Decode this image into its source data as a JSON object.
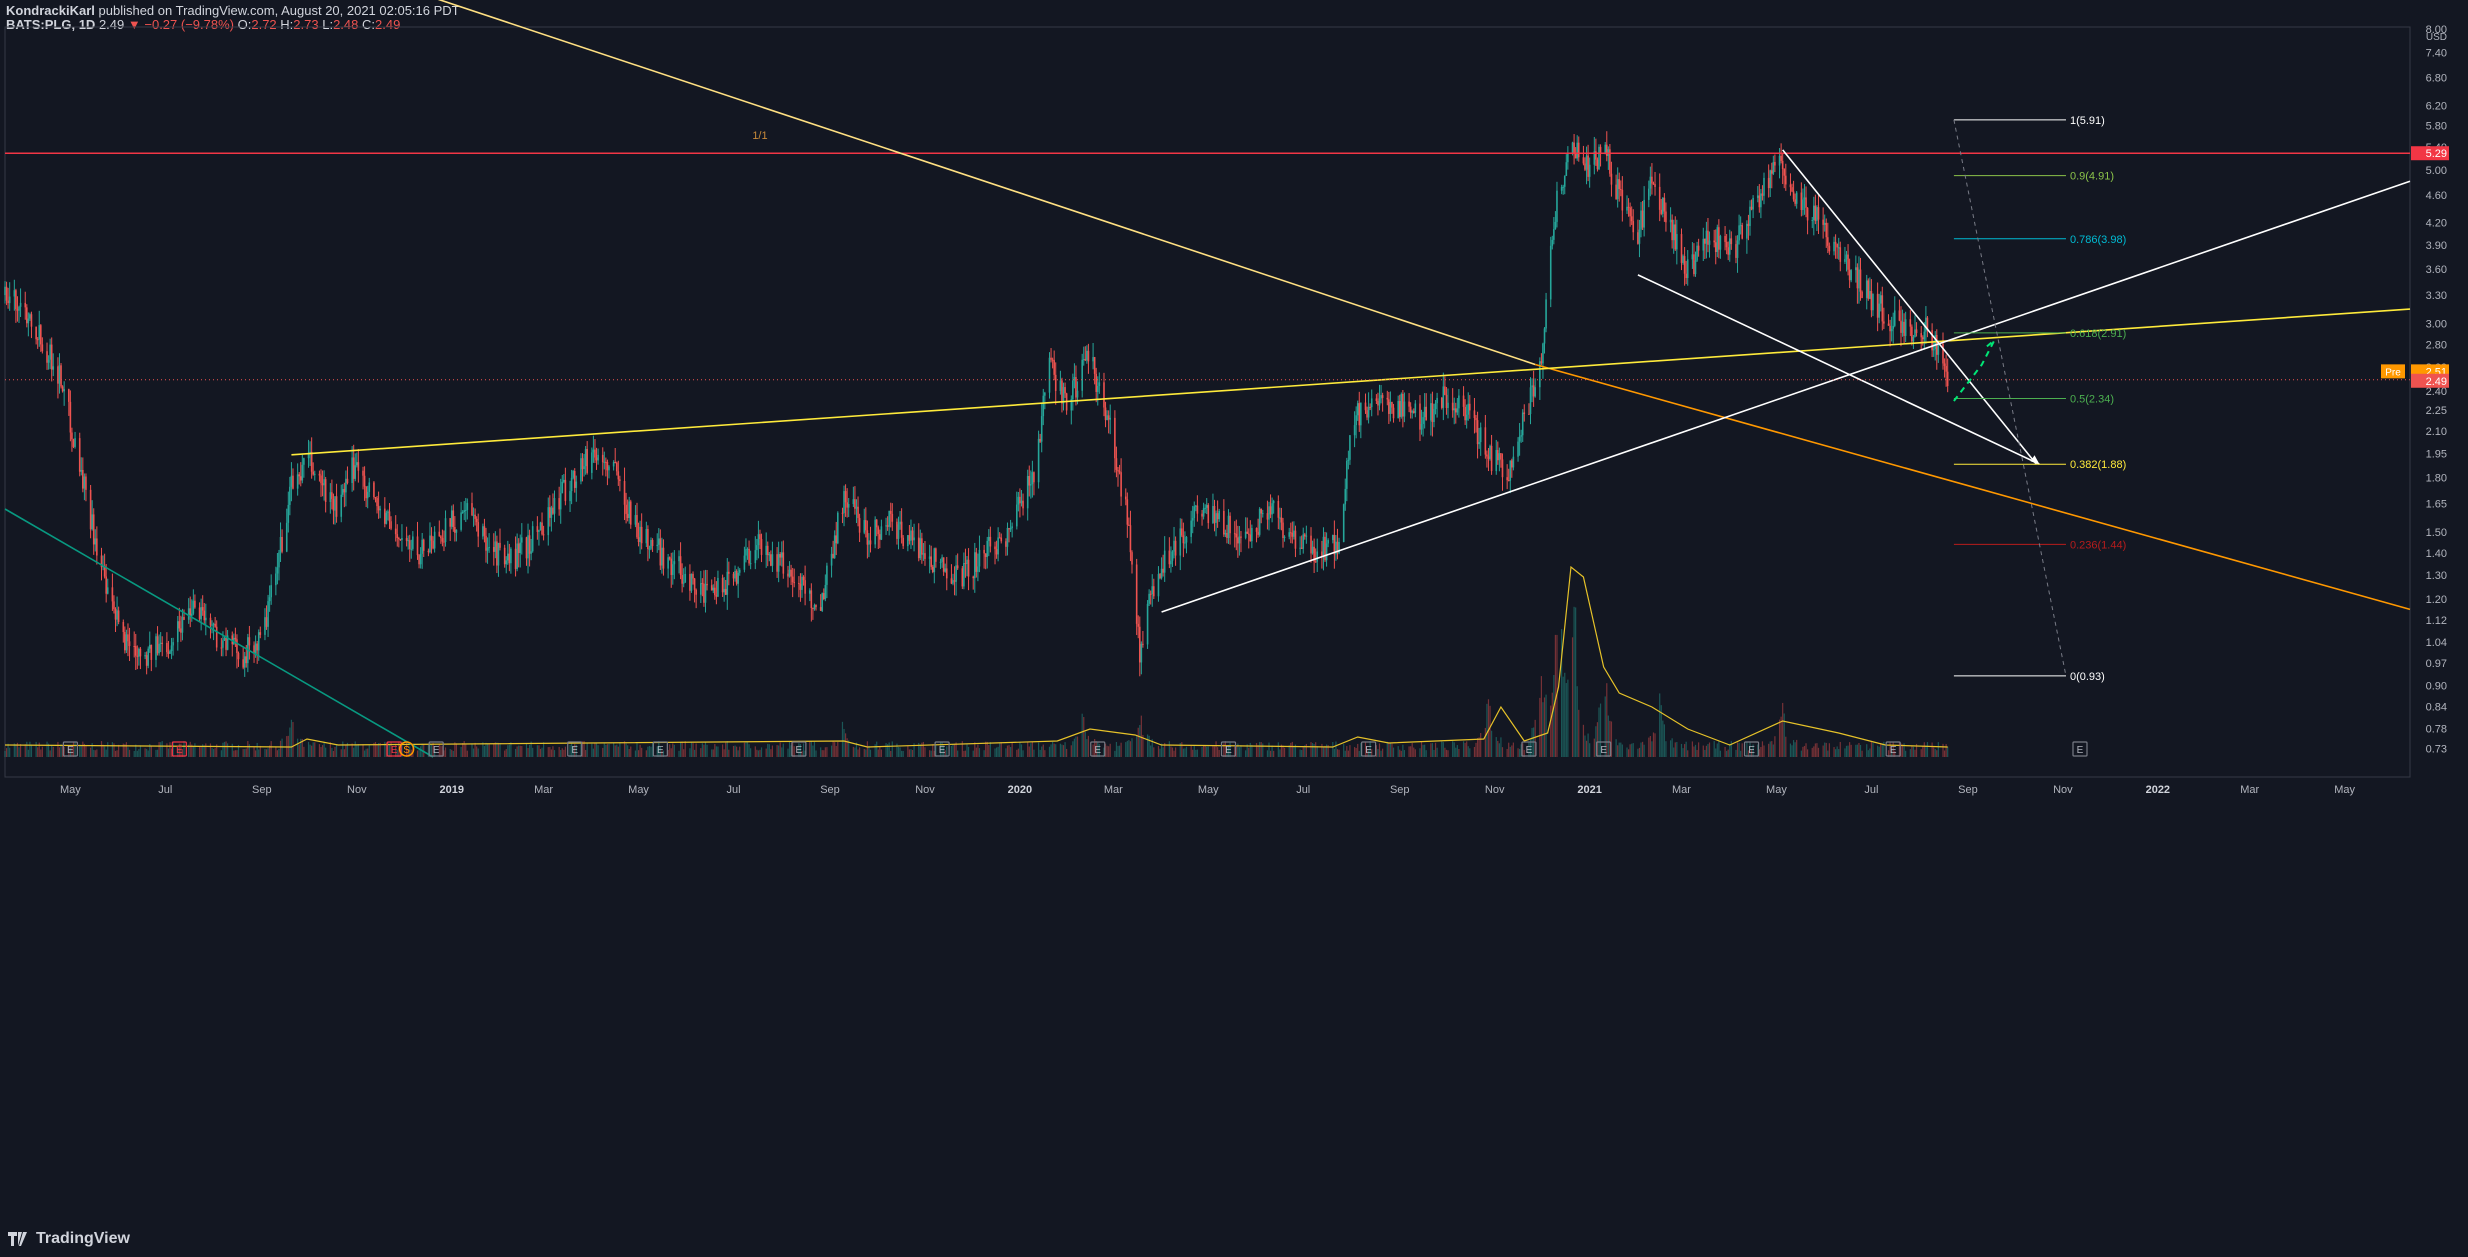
{
  "header": {
    "author": "KondrackiKarl",
    "published": "published on TradingView.com, August 20, 2021 02:05:16 PDT",
    "symbol": "BATS:PLG, 1D",
    "last": "2.49",
    "change": "▼ −0.27 (−9.78%)",
    "o_label": "O:",
    "o": "2.72",
    "h_label": "H:",
    "h": "2.73",
    "l_label": "L:",
    "l": "2.48",
    "c_label": "C:",
    "c": "2.49"
  },
  "watermark": "TradingView",
  "colors": {
    "background": "#131722",
    "up": "#26a69a",
    "down": "#ef5350",
    "trend_yellow": "#ffeb3b",
    "trend_orange": "#ff9800",
    "resistance_red": "#f23645",
    "fib_white": "#ffffff"
  },
  "chart_data": {
    "type": "candlestick",
    "price_scale": {
      "unit": "USD",
      "log": true,
      "ticks": [
        "8.00",
        "7.40",
        "6.80",
        "6.20",
        "5.80",
        "5.40",
        "5.00",
        "4.60",
        "4.20",
        "3.90",
        "3.60",
        "3.30",
        "3.00",
        "2.80",
        "2.60",
        "2.40",
        "2.25",
        "2.10",
        "1.95",
        "1.80",
        "1.65",
        "1.50",
        "1.40",
        "1.30",
        "1.20",
        "1.12",
        "1.04",
        "0.97",
        "0.90",
        "0.84",
        "0.78",
        "0.73"
      ],
      "range": [
        0.71,
        8.05
      ]
    },
    "time_scale": {
      "range": [
        "2018-03-20",
        "2022-06-12"
      ],
      "ticks": [
        {
          "label": "May",
          "date": "2018-05-01"
        },
        {
          "label": "Jul",
          "date": "2018-07-01"
        },
        {
          "label": "Sep",
          "date": "2018-09-01"
        },
        {
          "label": "Nov",
          "date": "2018-11-01"
        },
        {
          "label": "2019",
          "date": "2019-01-01",
          "bold": true
        },
        {
          "label": "Mar",
          "date": "2019-03-01"
        },
        {
          "label": "May",
          "date": "2019-05-01"
        },
        {
          "label": "Jul",
          "date": "2019-07-01"
        },
        {
          "label": "Sep",
          "date": "2019-09-01"
        },
        {
          "label": "Nov",
          "date": "2019-11-01"
        },
        {
          "label": "2020",
          "date": "2020-01-01",
          "bold": true
        },
        {
          "label": "Mar",
          "date": "2020-03-01"
        },
        {
          "label": "May",
          "date": "2020-05-01"
        },
        {
          "label": "Jul",
          "date": "2020-07-01"
        },
        {
          "label": "Sep",
          "date": "2020-09-01"
        },
        {
          "label": "Nov",
          "date": "2020-11-01"
        },
        {
          "label": "2021",
          "date": "2021-01-01",
          "bold": true
        },
        {
          "label": "Mar",
          "date": "2021-03-01"
        },
        {
          "label": "May",
          "date": "2021-05-01"
        },
        {
          "label": "Jul",
          "date": "2021-07-01"
        },
        {
          "label": "Sep",
          "date": "2021-09-01"
        },
        {
          "label": "Nov",
          "date": "2021-11-01"
        },
        {
          "label": "2022",
          "date": "2022-01-01",
          "bold": true
        },
        {
          "label": "Mar",
          "date": "2022-03-01"
        },
        {
          "label": "May",
          "date": "2022-05-01"
        }
      ]
    },
    "price_path": [
      [
        "2018-03-20",
        3.3
      ],
      [
        "2018-04-05",
        3.1
      ],
      [
        "2018-04-25",
        2.5
      ],
      [
        "2018-05-10",
        1.75
      ],
      [
        "2018-05-25",
        1.2
      ],
      [
        "2018-06-05",
        1.05
      ],
      [
        "2018-06-20",
        1.0
      ],
      [
        "2018-07-05",
        1.05
      ],
      [
        "2018-07-20",
        1.2
      ],
      [
        "2018-08-05",
        1.05
      ],
      [
        "2018-08-20",
        1.0
      ],
      [
        "2018-09-01",
        1.05
      ],
      [
        "2018-09-10",
        1.3
      ],
      [
        "2018-09-20",
        1.75
      ],
      [
        "2018-10-01",
        1.9
      ],
      [
        "2018-10-10",
        1.75
      ],
      [
        "2018-10-20",
        1.6
      ],
      [
        "2018-10-31",
        1.9
      ],
      [
        "2018-11-10",
        1.7
      ],
      [
        "2018-11-25",
        1.5
      ],
      [
        "2018-12-10",
        1.4
      ],
      [
        "2018-12-25",
        1.5
      ],
      [
        "2019-01-10",
        1.6
      ],
      [
        "2019-01-25",
        1.45
      ],
      [
        "2019-02-05",
        1.35
      ],
      [
        "2019-02-20",
        1.45
      ],
      [
        "2019-03-05",
        1.6
      ],
      [
        "2019-03-20",
        1.8
      ],
      [
        "2019-04-01",
        1.95
      ],
      [
        "2019-04-15",
        1.85
      ],
      [
        "2019-05-01",
        1.5
      ],
      [
        "2019-05-15",
        1.4
      ],
      [
        "2019-06-01",
        1.3
      ],
      [
        "2019-06-15",
        1.2
      ],
      [
        "2019-07-01",
        1.3
      ],
      [
        "2019-07-15",
        1.45
      ],
      [
        "2019-08-01",
        1.35
      ],
      [
        "2019-08-15",
        1.25
      ],
      [
        "2019-08-25",
        1.15
      ],
      [
        "2019-09-10",
        1.7
      ],
      [
        "2019-09-25",
        1.5
      ],
      [
        "2019-10-10",
        1.55
      ],
      [
        "2019-10-25",
        1.45
      ],
      [
        "2019-11-10",
        1.35
      ],
      [
        "2019-11-25",
        1.3
      ],
      [
        "2019-12-10",
        1.4
      ],
      [
        "2019-12-25",
        1.5
      ],
      [
        "2020-01-10",
        1.85
      ],
      [
        "2020-01-20",
        2.6
      ],
      [
        "2020-02-01",
        2.3
      ],
      [
        "2020-02-15",
        2.7
      ],
      [
        "2020-02-28",
        2.1
      ],
      [
        "2020-03-10",
        1.6
      ],
      [
        "2020-03-18",
        1.0
      ],
      [
        "2020-03-28",
        1.3
      ],
      [
        "2020-04-10",
        1.45
      ],
      [
        "2020-04-25",
        1.6
      ],
      [
        "2020-05-10",
        1.55
      ],
      [
        "2020-05-25",
        1.45
      ],
      [
        "2020-06-10",
        1.65
      ],
      [
        "2020-06-25",
        1.45
      ],
      [
        "2020-07-10",
        1.4
      ],
      [
        "2020-07-25",
        1.45
      ],
      [
        "2020-08-01",
        2.2
      ],
      [
        "2020-08-15",
        2.25
      ],
      [
        "2020-09-01",
        2.3
      ],
      [
        "2020-09-15",
        2.2
      ],
      [
        "2020-10-01",
        2.35
      ],
      [
        "2020-10-15",
        2.2
      ],
      [
        "2020-10-31",
        1.9
      ],
      [
        "2020-11-10",
        1.85
      ],
      [
        "2020-11-20",
        2.2
      ],
      [
        "2020-12-01",
        2.7
      ],
      [
        "2020-12-10",
        4.4
      ],
      [
        "2020-12-20",
        5.5
      ],
      [
        "2020-12-31",
        5.0
      ],
      [
        "2021-01-10",
        5.4
      ],
      [
        "2021-01-20",
        4.6
      ],
      [
        "2021-01-31",
        4.0
      ],
      [
        "2021-02-10",
        4.8
      ],
      [
        "2021-02-20",
        4.2
      ],
      [
        "2021-03-05",
        3.6
      ],
      [
        "2021-03-20",
        4.0
      ],
      [
        "2021-04-05",
        3.9
      ],
      [
        "2021-04-20",
        4.6
      ],
      [
        "2021-05-01",
        5.2
      ],
      [
        "2021-05-10",
        4.7
      ],
      [
        "2021-05-25",
        4.3
      ],
      [
        "2021-06-10",
        3.8
      ],
      [
        "2021-06-25",
        3.4
      ],
      [
        "2021-07-10",
        3.1
      ],
      [
        "2021-07-25",
        2.9
      ],
      [
        "2021-08-05",
        2.95
      ],
      [
        "2021-08-12",
        2.75
      ],
      [
        "2021-08-16",
        2.72
      ],
      [
        "2021-08-19",
        2.49
      ]
    ],
    "volume_spikes": [
      [
        "2020-12-01",
        0.45
      ],
      [
        "2020-12-12",
        1.0
      ],
      [
        "2020-12-22",
        0.85
      ],
      [
        "2021-01-10",
        0.5
      ],
      [
        "2021-02-15",
        0.25
      ],
      [
        "2020-02-10",
        0.2
      ],
      [
        "2020-03-18",
        0.18
      ],
      [
        "2019-09-10",
        0.12
      ],
      [
        "2018-09-20",
        0.12
      ],
      [
        "2021-05-05",
        0.2
      ],
      [
        "2020-10-28",
        0.3
      ]
    ],
    "volume_ma": [
      [
        "2018-03-20",
        0.06
      ],
      [
        "2018-09-20",
        0.05
      ],
      [
        "2018-09-30",
        0.09
      ],
      [
        "2018-10-20",
        0.06
      ],
      [
        "2019-09-10",
        0.08
      ],
      [
        "2019-09-25",
        0.05
      ],
      [
        "2020-01-25",
        0.08
      ],
      [
        "2020-02-15",
        0.14
      ],
      [
        "2020-03-15",
        0.11
      ],
      [
        "2020-04-01",
        0.06
      ],
      [
        "2020-07-20",
        0.05
      ],
      [
        "2020-08-05",
        0.1
      ],
      [
        "2020-08-25",
        0.07
      ],
      [
        "2020-10-25",
        0.09
      ],
      [
        "2020-11-05",
        0.25
      ],
      [
        "2020-11-20",
        0.08
      ],
      [
        "2020-12-05",
        0.12
      ],
      [
        "2020-12-12",
        0.35
      ],
      [
        "2020-12-20",
        0.95
      ],
      [
        "2020-12-28",
        0.9
      ],
      [
        "2021-01-10",
        0.45
      ],
      [
        "2021-01-20",
        0.32
      ],
      [
        "2021-02-10",
        0.25
      ],
      [
        "2021-03-05",
        0.14
      ],
      [
        "2021-04-01",
        0.06
      ],
      [
        "2021-05-05",
        0.18
      ],
      [
        "2021-06-10",
        0.12
      ],
      [
        "2021-07-10",
        0.06
      ],
      [
        "2021-08-19",
        0.05
      ]
    ],
    "trendlines": [
      {
        "name": "yellow-descending",
        "color": "#ffe082",
        "p1": [
          "2018-12-12",
          9.0
        ],
        "p2": [
          "2020-11-27",
          2.62
        ]
      },
      {
        "name": "orange-descending-extension",
        "color": "#ff9800",
        "p1": [
          "2020-11-27",
          2.62
        ],
        "p2": [
          "2022-06-12",
          1.16
        ]
      },
      {
        "name": "yellow-ascending",
        "color": "#ffeb3b",
        "p1": [
          "2018-09-20",
          1.94
        ],
        "p2": [
          "2022-06-12",
          3.15
        ]
      },
      {
        "name": "green-descending",
        "color": "#089981",
        "p1": [
          "2018-03-20",
          1.62
        ],
        "p2": [
          "2018-12-20",
          0.71
        ]
      },
      {
        "name": "white-ascending",
        "color": "#ffffff",
        "p1": [
          "2020-04-01",
          1.15
        ],
        "p2": [
          "2022-06-12",
          4.82
        ]
      },
      {
        "name": "white-wedge-upper",
        "color": "#ffffff",
        "p1": [
          "2021-05-05",
          5.35
        ],
        "p2": [
          "2021-10-15",
          1.88
        ]
      },
      {
        "name": "white-wedge-lower",
        "color": "#ffffff",
        "p1": [
          "2021-02-01",
          3.53
        ],
        "p2": [
          "2021-10-17",
          1.88
        ]
      }
    ],
    "resistance": {
      "value": 5.29,
      "label": "5.29",
      "color": "#f23645"
    },
    "current_price": {
      "value": 2.49,
      "label": "2.49",
      "pre_value": 2.51,
      "pre_label": "2.51",
      "pre_tag": "Pre"
    },
    "trendline_label": {
      "text": "1/1",
      "at": [
        "2019-07-18",
        5.55
      ]
    },
    "projection_path": [
      [
        "2021-08-23",
        2.32
      ],
      [
        "2021-09-10",
        2.62
      ],
      [
        "2021-09-18",
        2.84
      ],
      [
        "2021-09-13",
        2.78
      ]
    ],
    "fib_levels": [
      {
        "ratio": "1",
        "price": 5.91,
        "label": "1(5.91)",
        "color": "#ffffff"
      },
      {
        "ratio": "0.9",
        "price": 4.91,
        "label": "0.9(4.91)",
        "color": "#8bc34a"
      },
      {
        "ratio": "0.786",
        "price": 3.98,
        "label": "0.786(3.98)",
        "color": "#00bcd4"
      },
      {
        "ratio": "0.618",
        "price": 2.91,
        "label": "0.618(2.91)",
        "color": "#4caf50"
      },
      {
        "ratio": "0.5",
        "price": 2.34,
        "label": "0.5(2.34)",
        "color": "#4caf50"
      },
      {
        "ratio": "0.382",
        "price": 1.88,
        "label": "0.382(1.88)",
        "color": "#ffeb3b"
      },
      {
        "ratio": "0.236",
        "price": 1.44,
        "label": "0.236(1.44)",
        "color": "#b71c1c"
      },
      {
        "ratio": "0",
        "price": 0.93,
        "label": "0(0.93)",
        "color": "#ffffff"
      }
    ],
    "fib_range": [
      "2021-08-23",
      "2021-11-03"
    ],
    "fib_trend": [
      [
        "2021-08-23",
        5.91
      ],
      [
        "2021-11-03",
        0.93
      ]
    ],
    "events": [
      {
        "type": "E",
        "date": "2018-05-01",
        "color": "#787b86"
      },
      {
        "type": "E",
        "date": "2018-07-10",
        "color": "#f23645"
      },
      {
        "type": "E",
        "date": "2018-11-25",
        "color": "#f23645"
      },
      {
        "type": "S",
        "date": "2018-12-03",
        "color": "#ff9800"
      },
      {
        "type": "E",
        "date": "2018-12-22",
        "color": "#787b86"
      },
      {
        "type": "E",
        "date": "2019-03-21",
        "color": "#787b86"
      },
      {
        "type": "E",
        "date": "2019-05-15",
        "color": "#787b86"
      },
      {
        "type": "E",
        "date": "2019-08-12",
        "color": "#787b86"
      },
      {
        "type": "E",
        "date": "2019-11-12",
        "color": "#787b86"
      },
      {
        "type": "E",
        "date": "2020-02-20",
        "color": "#787b86"
      },
      {
        "type": "E",
        "date": "2020-05-14",
        "color": "#787b86"
      },
      {
        "type": "E",
        "date": "2020-08-12",
        "color": "#787b86"
      },
      {
        "type": "E",
        "date": "2020-11-23",
        "color": "#787b86"
      },
      {
        "type": "E",
        "date": "2021-01-10",
        "color": "#787b86"
      },
      {
        "type": "E",
        "date": "2021-04-15",
        "color": "#787b86"
      },
      {
        "type": "E",
        "date": "2021-07-15",
        "color": "#787b86"
      },
      {
        "type": "E",
        "date": "2021-11-12",
        "color": "#787b86"
      }
    ]
  }
}
